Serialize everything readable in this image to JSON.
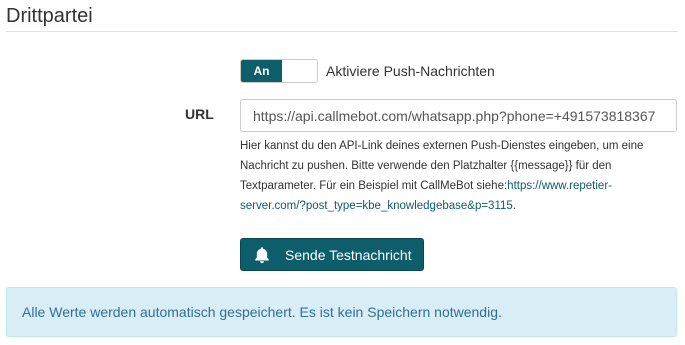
{
  "section": {
    "title": "Drittpartei"
  },
  "push_toggle": {
    "state_label": "An",
    "label": "Aktiviere Push-Nachrichten"
  },
  "url_field": {
    "label": "URL",
    "value": "https://api.callmebot.com/whatsapp.php?phone=+491573818367",
    "help_text": "Hier kannst du den API-Link deines externen Push-Dienstes eingeben, um eine Nachricht zu pushen. Bitte verwende den Platzhalter {{message}} für den Textparameter. Für ein Beispiel mit CallMeBot siehe:",
    "help_link": "https://www.repetier-server.com/?post_type=kbe_knowledgebase&p=3115",
    "help_suffix": "."
  },
  "test_button": {
    "label": "Sende Testnachricht",
    "icon": "bell-icon"
  },
  "alert": {
    "text": "Alle Werte werden automatisch gespeichert. Es ist kein Speichern notwendig."
  },
  "colors": {
    "accent": "#0e5d6b",
    "alert_bg": "#d9edf7",
    "alert_text": "#31708f"
  }
}
